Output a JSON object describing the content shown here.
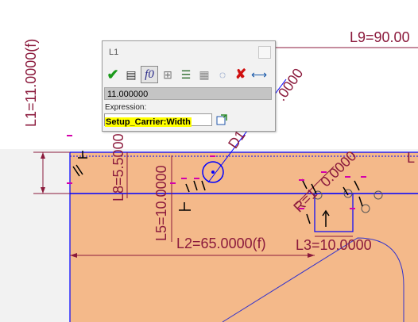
{
  "dimensions": {
    "l9": "L9=90.00",
    "l1": "L1=11.0000(f)",
    "l8": "L8=5.5000",
    "l5": "L5=10.0000",
    "l2": "L2=65.0000(f)",
    "l3": "L3=10.0000",
    "d1": "D1",
    "d_partial": ".0000",
    "r": "R=1",
    "r_value": "0.0000",
    "top_right": "L"
  },
  "dialog": {
    "title": "L1",
    "toolbar": [
      {
        "name": "accept-check-icon",
        "glyph": "✔",
        "color": "#1a9a1a"
      },
      {
        "name": "parameters-icon",
        "glyph": "▤",
        "color": "#333"
      },
      {
        "name": "function-icon",
        "glyph": "f0",
        "color": "#2a2a8a"
      },
      {
        "name": "measure-icon",
        "glyph": "⊞",
        "color": "#666"
      },
      {
        "name": "list-icon",
        "glyph": "☰",
        "color": "#333"
      },
      {
        "name": "table-icon",
        "glyph": "▦",
        "color": "#777"
      },
      {
        "name": "reference-icon",
        "glyph": "◌",
        "color": "#4466aa"
      },
      {
        "name": "cancel-x-icon",
        "glyph": "✘",
        "color": "#d01010"
      },
      {
        "name": "dimension-icon",
        "glyph": "⟷",
        "color": "#1a5aaa"
      }
    ],
    "value": "11.000000",
    "expression_label": "Expression:",
    "expression_value": "Setup_Carrier:Width"
  },
  "colors": {
    "part_fill": "#f4b98a",
    "dimension": "#8b1a3c",
    "geometry": "#0000ff",
    "highlight": "#ffff00"
  }
}
